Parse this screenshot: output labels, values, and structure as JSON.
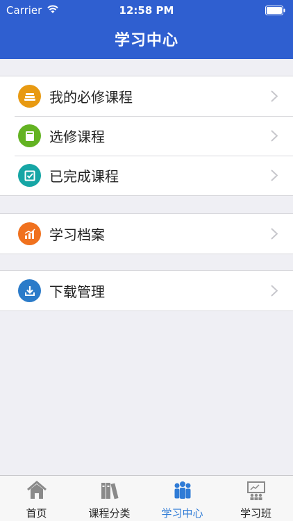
{
  "status_bar": {
    "carrier": "Carrier",
    "time": "12:58 PM",
    "wifi_icon": "wifi-icon",
    "battery_icon": "battery-icon"
  },
  "nav": {
    "title": "学习中心"
  },
  "groups": [
    {
      "rows": [
        {
          "label": "我的必修课程",
          "icon": "stack-icon",
          "color": "#e89a12"
        },
        {
          "label": "选修课程",
          "icon": "book-icon",
          "color": "#63b322"
        },
        {
          "label": "已完成课程",
          "icon": "check-icon",
          "color": "#16a6a5"
        }
      ]
    },
    {
      "rows": [
        {
          "label": "学习档案",
          "icon": "chart-icon",
          "color": "#f0711e"
        }
      ]
    },
    {
      "rows": [
        {
          "label": "下载管理",
          "icon": "download-icon",
          "color": "#2b7bc9"
        }
      ]
    }
  ],
  "tabbar": {
    "active_color": "#2f7bd6",
    "tabs": [
      {
        "label": "首页",
        "icon": "home-icon",
        "active": false
      },
      {
        "label": "课程分类",
        "icon": "books-icon",
        "active": false
      },
      {
        "label": "学习中心",
        "icon": "people-icon",
        "active": true
      },
      {
        "label": "学习班",
        "icon": "classroom-icon",
        "active": false
      }
    ]
  }
}
